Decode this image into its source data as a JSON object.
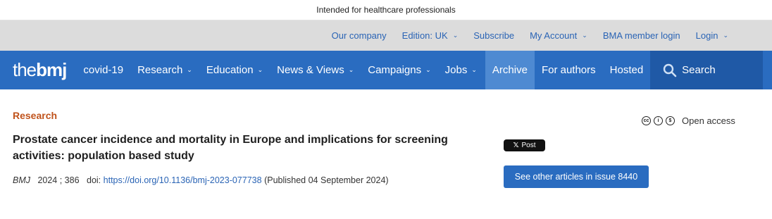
{
  "topbar": {
    "notice": "Intended for healthcare professionals"
  },
  "utility": {
    "links": [
      {
        "label": "Our company",
        "caret": false
      },
      {
        "label": "Edition: UK",
        "caret": true
      },
      {
        "label": "Subscribe",
        "caret": false
      },
      {
        "label": "My Account",
        "caret": true
      },
      {
        "label": "BMA member login",
        "caret": false
      },
      {
        "label": "Login",
        "caret": true
      }
    ]
  },
  "nav": {
    "logo_the": "the",
    "logo_bmj": "bmj",
    "items": [
      {
        "label": "covid-19"
      },
      {
        "label": "Research"
      },
      {
        "label": "Education"
      },
      {
        "label": "News & Views"
      },
      {
        "label": "Campaigns"
      },
      {
        "label": "Jobs"
      },
      {
        "label": "Archive"
      },
      {
        "label": "For authors"
      },
      {
        "label": "Hosted"
      }
    ],
    "search_label": "Search"
  },
  "article": {
    "section": "Research",
    "title": "Prostate cancer incidence and mortality in Europe and implications for screening activities: population based study",
    "journal": "BMJ",
    "year_volume": "2024 ; 386",
    "doi_label": "doi:",
    "doi_url": "https://doi.org/10.1136/bmj-2023-077738",
    "published": "(Published 04 September 2024)"
  },
  "sidebar": {
    "open_access_label": "Open access",
    "license_icons": [
      "cc-icon",
      "by-icon",
      "nc-icon"
    ],
    "xpost_label": "Post",
    "other_articles_label": "See other articles in issue 8440"
  },
  "colors": {
    "nav_blue": "#2a6cc0",
    "archive_blue": "#4e8ad2",
    "search_blue": "#1f59a6",
    "section_orange": "#c0531c",
    "link_blue": "#2a64b5"
  }
}
